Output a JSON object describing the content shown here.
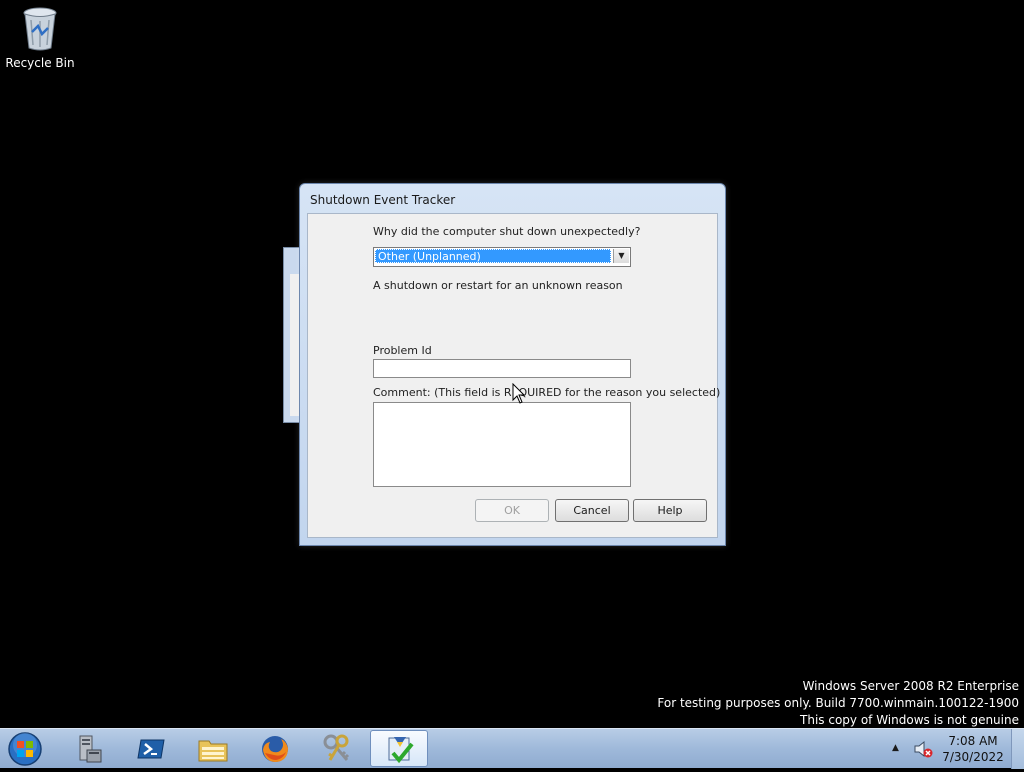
{
  "desktop": {
    "icons": [
      {
        "label": "Recycle Bin",
        "icon": "recycle-bin-icon"
      }
    ]
  },
  "dialog": {
    "title": "Shutdown Event Tracker",
    "question": "Why did the computer shut down unexpectedly?",
    "reason_select": {
      "selected": "Other (Unplanned)"
    },
    "reason_description": "A shutdown or restart for an unknown reason",
    "problem_id": {
      "label": "Problem Id",
      "value": ""
    },
    "comment": {
      "label": "Comment: (This field is REQUIRED for the reason you selected)",
      "value": ""
    },
    "buttons": {
      "ok": "OK",
      "cancel": "Cancel",
      "help": "Help"
    }
  },
  "watermark": {
    "line1": "Windows Server 2008 R2 Enterprise",
    "line2": "For testing purposes only. Build 7700.winmain.100122-1900",
    "line3": "This copy of Windows is not genuine"
  },
  "taskbar": {
    "start": "start-orb-icon",
    "pinned": [
      {
        "icon": "server-manager-icon"
      },
      {
        "icon": "powershell-icon"
      },
      {
        "icon": "file-explorer-icon"
      },
      {
        "icon": "firefox-icon"
      },
      {
        "icon": "keys-tool-icon"
      },
      {
        "icon": "shutdown-event-tracker-icon",
        "active": true
      }
    ],
    "tray": {
      "show_hidden": "show-hidden-icons-arrow",
      "sound": "sound-muted-icon"
    },
    "clock": {
      "time": "7:08 AM",
      "date": "7/30/2022"
    }
  },
  "colors": {
    "taskbar": "#9fb9da",
    "selection": "#3399ff",
    "dialog_frame": "#c2d5ee",
    "dialog_client": "#f0f0f0"
  }
}
